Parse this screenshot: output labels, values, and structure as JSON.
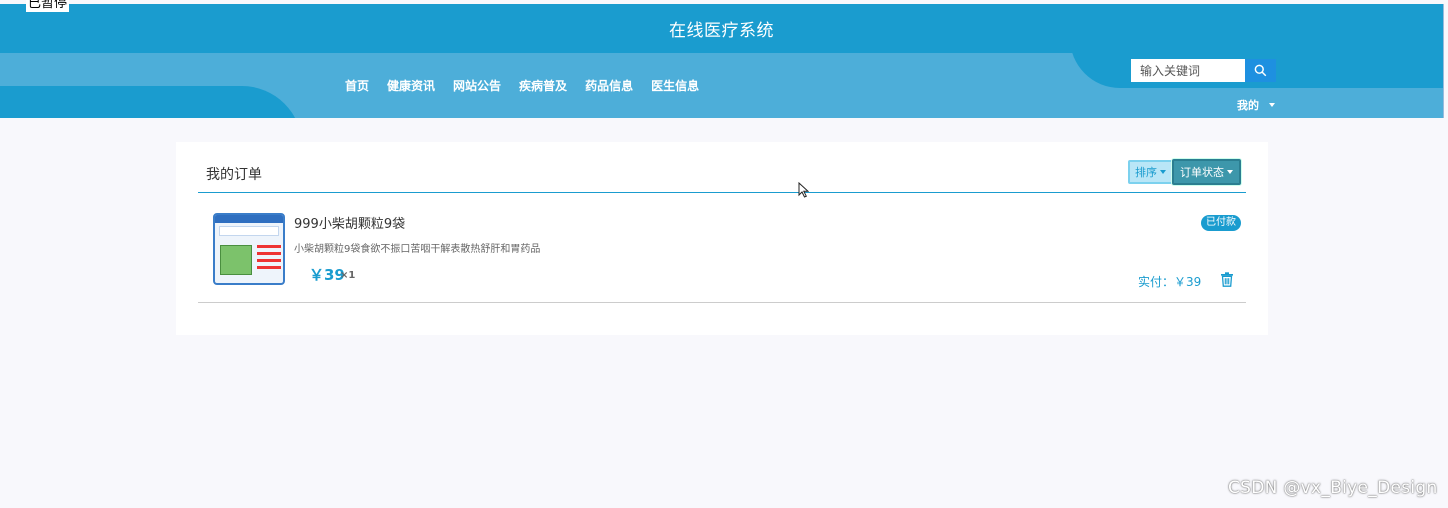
{
  "overlay": {
    "paused_label": "已暂停"
  },
  "header": {
    "site_title": "在线医疗系统",
    "nav": [
      "首页",
      "健康资讯",
      "网站公告",
      "疾病普及",
      "药品信息",
      "医生信息"
    ],
    "search": {
      "placeholder": "输入关键词"
    },
    "user_menu": "我的"
  },
  "orders": {
    "title": "我的订单",
    "sort_label": "排序",
    "status_label": "订单状态",
    "items": [
      {
        "name": "999小柴胡颗粒9袋",
        "description": "小柴胡颗粒9袋食欲不振口苦咽干解表散热舒肝和胃药品",
        "price": "￥39",
        "quantity": "×1",
        "status": "已付款",
        "paid_label": "实付：￥39"
      }
    ]
  },
  "watermark": "CSDN @vx_Biye_Design",
  "colors": {
    "primary": "#1a9ccf",
    "band": "#4daed9",
    "page_bg": "#f8f8fc"
  }
}
